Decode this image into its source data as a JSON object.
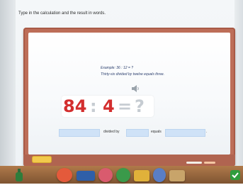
{
  "instruction": "Type in the calculation and the result in words.",
  "example": {
    "line1": "Example: 36 : 12 = ?",
    "line2": "Thirty-six divided by twelve equals three."
  },
  "calculation": {
    "dividend": "84",
    "operator": ":",
    "divisor": "4",
    "equals": "=",
    "unknown": "?"
  },
  "answer_line": {
    "dividend_value": "",
    "divided_by_label": "divided by",
    "divisor_value": "",
    "equals_label": "equals",
    "result_value": "",
    "period": "."
  },
  "colors": {
    "board_frame": "#bd6e58",
    "number_red": "#d32e2e",
    "input_blue": "#cfe2f7",
    "check_green": "#2e9d3c"
  },
  "icons": [
    "speaker-icon",
    "sponge-icon",
    "chalk-icon",
    "bottle-icon",
    "toolbar-tool-icon",
    "check-icon"
  ]
}
